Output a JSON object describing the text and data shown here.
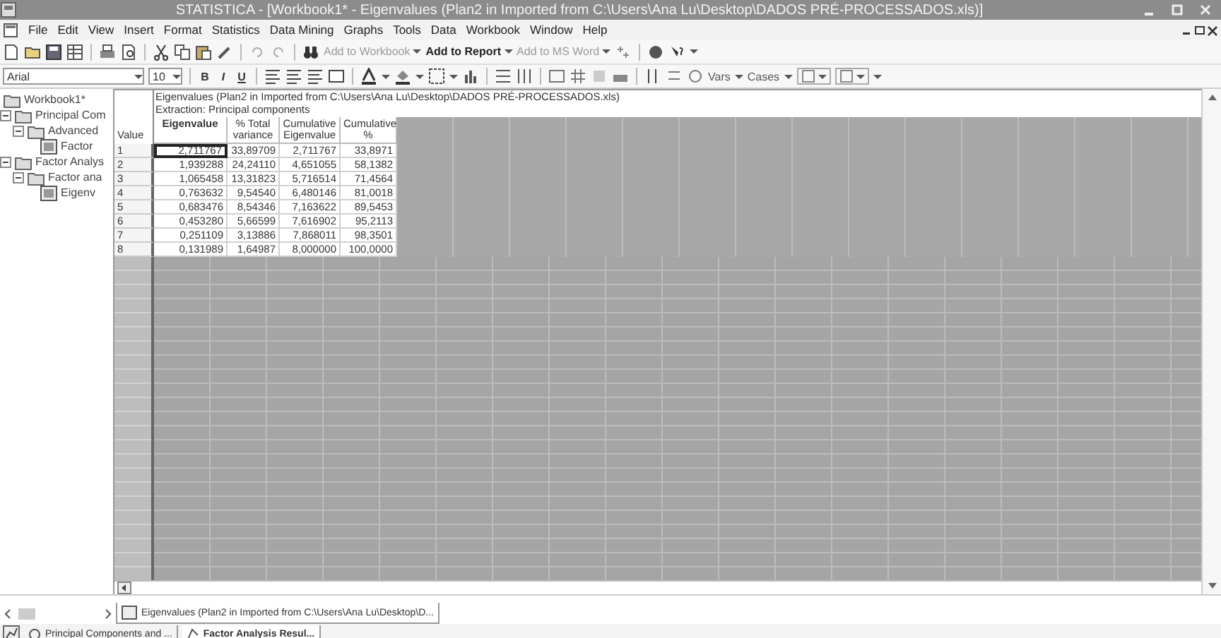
{
  "window": {
    "title": "STATISTICA - [Workbook1* - Eigenvalues (Plan2 in Imported from C:\\Users\\Ana Lu\\Desktop\\DADOS PRÉ-PROCESSADOS.xls)]"
  },
  "menu": [
    "File",
    "Edit",
    "View",
    "Insert",
    "Format",
    "Statistics",
    "Data Mining",
    "Graphs",
    "Tools",
    "Data",
    "Workbook",
    "Window",
    "Help"
  ],
  "toolbar": [
    {
      "label": "Add to Workbook",
      "disabled": true
    },
    {
      "label": "Add to Report",
      "disabled": false
    },
    {
      "label": "Add to MS Word",
      "disabled": true
    }
  ],
  "format_bar": {
    "font": "Arial",
    "size": "10",
    "styles": [
      "B",
      "I",
      "U"
    ],
    "vars": "Vars",
    "cases": "Cases"
  },
  "tree": [
    {
      "label": "Workbook1*",
      "children": [
        {
          "label": "Principal Com",
          "expanded": true,
          "children": [
            {
              "label": "Advanced",
              "expanded": true,
              "children": [
                {
                  "label": "Factor"
                }
              ]
            }
          ]
        },
        {
          "label": "Factor Analys",
          "expanded": true,
          "children": [
            {
              "label": "Factor ana",
              "expanded": true,
              "children": [
                {
                  "label": "Eigenv"
                }
              ]
            }
          ]
        }
      ]
    }
  ],
  "sheet": {
    "title_lines": [
      "Eigenvalues (Plan2 in Imported from C:\\Users\\Ana Lu\\Desktop\\DADOS PRÉ-PROCESSADOS.xls)",
      "Extraction: Principal components"
    ],
    "row_header": "Value",
    "columns": [
      "Eigenvalue",
      "% Total variance",
      "Cumulative Eigenvalue",
      "Cumulative %"
    ],
    "rows": [
      {
        "label": "1",
        "selected": true,
        "values": [
          "2,711767",
          "33,89709",
          "2,711767",
          "33,8971"
        ]
      },
      {
        "label": "2",
        "selected": false,
        "values": [
          "1,939288",
          "24,24110",
          "4,651055",
          "58,1382"
        ]
      },
      {
        "label": "3",
        "selected": false,
        "values": [
          "1,065458",
          "13,31823",
          "5,716514",
          "71,4564"
        ]
      },
      {
        "label": "4",
        "selected": false,
        "values": [
          "0,763632",
          "9,54540",
          "6,480146",
          "81,0018"
        ]
      },
      {
        "label": "5",
        "selected": false,
        "values": [
          "0,683476",
          "8,54346",
          "7,163622",
          "89,5453"
        ]
      },
      {
        "label": "6",
        "selected": false,
        "values": [
          "0,453280",
          "5,66599",
          "7,616902",
          "95,2113"
        ]
      },
      {
        "label": "7",
        "selected": false,
        "values": [
          "0,251109",
          "3,13886",
          "7,868011",
          "98,3501"
        ]
      },
      {
        "label": "8",
        "selected": false,
        "values": [
          "0,131989",
          "1,64987",
          "8,000000",
          "100,0000"
        ]
      }
    ]
  },
  "sheet_tabs": [
    {
      "label": "Eigenvalues (Plan2 in Imported from C:\\Users\\Ana Lu\\Desktop\\D...",
      "selected": true
    }
  ],
  "taskbar": [
    {
      "label": "Principal Components and ...",
      "selected": false
    },
    {
      "label": "Factor Analysis Resul...",
      "selected": true
    }
  ]
}
